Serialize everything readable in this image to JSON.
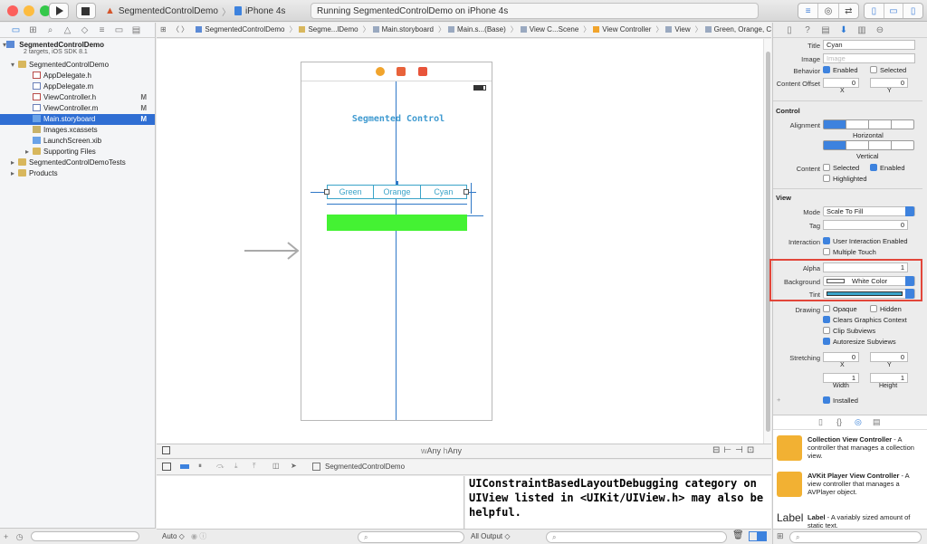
{
  "window": {
    "scheme_name": "SegmentedControlDemo",
    "device": "iPhone 4s",
    "activity": "Running SegmentedControlDemo on iPhone 4s"
  },
  "navigator": {
    "project_name": "SegmentedControlDemo",
    "project_subtitle": "2 targets, iOS SDK 8.1",
    "items": [
      {
        "label": "SegmentedControlDemo",
        "kind": "folder",
        "indent": 1,
        "badge": ""
      },
      {
        "label": "AppDelegate.h",
        "kind": "h",
        "indent": 2,
        "badge": ""
      },
      {
        "label": "AppDelegate.m",
        "kind": "m",
        "indent": 2,
        "badge": ""
      },
      {
        "label": "ViewController.h",
        "kind": "h",
        "indent": 2,
        "badge": "M"
      },
      {
        "label": "ViewController.m",
        "kind": "m",
        "indent": 2,
        "badge": "M"
      },
      {
        "label": "Main.storyboard",
        "kind": "sb",
        "indent": 2,
        "badge": "M",
        "selected": true
      },
      {
        "label": "Images.xcassets",
        "kind": "x",
        "indent": 2,
        "badge": ""
      },
      {
        "label": "LaunchScreen.xib",
        "kind": "sb",
        "indent": 2,
        "badge": ""
      },
      {
        "label": "Supporting Files",
        "kind": "folder",
        "indent": 2,
        "badge": ""
      },
      {
        "label": "SegmentedControlDemoTests",
        "kind": "folder",
        "indent": 1,
        "badge": ""
      },
      {
        "label": "Products",
        "kind": "folder",
        "indent": 1,
        "badge": ""
      }
    ]
  },
  "jumpbar": {
    "crumbs": [
      "SegmentedControlDemo",
      "Segme...lDemo",
      "Main.storyboard",
      "Main.s...(Base)",
      "View C...Scene",
      "View Controller",
      "View",
      "Green, Orange, Cyan"
    ]
  },
  "scene": {
    "title": "Segmented Control",
    "segments": [
      "Green",
      "Orange",
      "Cyan"
    ],
    "size_class_w": "w",
    "size_class_w_value": "Any",
    "size_class_h": "h",
    "size_class_h_value": "Any"
  },
  "debug": {
    "target_label": "SegmentedControlDemo",
    "console_text": "UIConstraintBasedLayoutDebugging category on UIView listed in <UIKit/UIView.h> may also be helpful.",
    "auto_label": "Auto ◇",
    "output_label": "All Output ◇"
  },
  "inspector": {
    "title_label": "Title",
    "title_value": "Cyan",
    "image_label": "Image",
    "image_placeholder": "Image",
    "behavior_label": "Behavior",
    "enabled_label": "Enabled",
    "selected_label": "Selected",
    "content_offset_label": "Content Offset",
    "offset_x": "0",
    "offset_y": "0",
    "x_label": "X",
    "y_label": "Y",
    "control_section": "Control",
    "alignment_label": "Alignment",
    "horizontal_label": "Horizontal",
    "vertical_label": "Vertical",
    "content_label": "Content",
    "content_selected": "Selected",
    "content_enabled": "Enabled",
    "content_highlighted": "Highlighted",
    "view_section": "View",
    "mode_label": "Mode",
    "mode_value": "Scale To Fill",
    "tag_label": "Tag",
    "tag_value": "0",
    "interaction_label": "Interaction",
    "user_interaction": "User Interaction Enabled",
    "multiple_touch": "Multiple Touch",
    "alpha_label": "Alpha",
    "alpha_value": "1",
    "background_label": "Background",
    "background_value": "White Color",
    "tint_label": "Tint",
    "tint_color": "#3aa3c8",
    "drawing_label": "Drawing",
    "opaque": "Opaque",
    "hidden": "Hidden",
    "clears_graphics": "Clears Graphics Context",
    "clip_subviews": "Clip Subviews",
    "autoresize": "Autoresize Subviews",
    "stretching_label": "Stretching",
    "stretch_x": "0",
    "stretch_y": "0",
    "stretch_w": "1",
    "stretch_h": "1",
    "width_label": "Width",
    "height_label": "Height",
    "installed_label": "Installed"
  },
  "library": {
    "items": [
      {
        "name": "Collection View Controller",
        "desc": " - A controller that manages a collection view."
      },
      {
        "name": "AVKit Player View Controller",
        "desc": " - A view controller that manages a AVPlayer object."
      },
      {
        "name": "Label",
        "desc": " - A variably sized amount of static text."
      }
    ],
    "label_icon_text": "Label"
  },
  "colors": {
    "accent": "#3d82de",
    "segment_tint": "#3aa3c8",
    "green_view": "#44f233",
    "highlight_box": "#e2463a"
  }
}
